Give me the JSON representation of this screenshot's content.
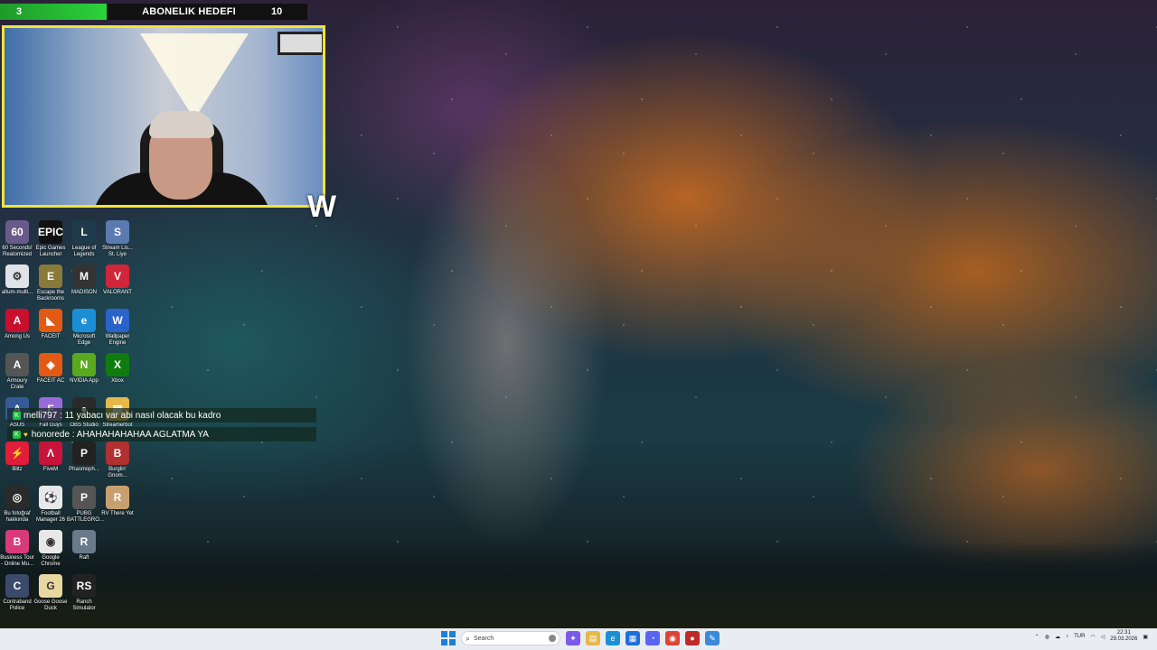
{
  "overlay": {
    "goal_count_left": "3",
    "goal_title": "ABONELIK HEDEFI",
    "goal_count_right": "10"
  },
  "desktop_icons": [
    {
      "label": "60 Seconds! Reatomized",
      "icon": "game-icon",
      "color": "#6a5a8a",
      "glyph": "60"
    },
    {
      "label": "Epic Games Launcher",
      "icon": "epic-games-icon",
      "color": "#111111",
      "glyph": "EPIC"
    },
    {
      "label": "League of Legends",
      "icon": "league-icon",
      "color": "#1f3a4a",
      "glyph": "L"
    },
    {
      "label": "Stream Lis... St. Liye",
      "icon": "stream-icon",
      "color": "#5a7ab0",
      "glyph": "S"
    },
    {
      "label": "altum-multi...",
      "icon": "file-icon",
      "color": "#dfe3e8",
      "glyph": "⚙"
    },
    {
      "label": "Escape the Backrooms",
      "icon": "game-icon",
      "color": "#8a7a3a",
      "glyph": "E"
    },
    {
      "label": "MADISON",
      "icon": "game-icon",
      "color": "#333333",
      "glyph": "M"
    },
    {
      "label": "VALORANT",
      "icon": "valorant-icon",
      "color": "#d0263a",
      "glyph": "V"
    },
    {
      "label": "Among Us",
      "icon": "among-us-icon",
      "color": "#c8102e",
      "glyph": "A"
    },
    {
      "label": "FACEIT",
      "icon": "faceit-icon",
      "color": "#e35a14",
      "glyph": "◣"
    },
    {
      "label": "Microsoft Edge",
      "icon": "edge-icon",
      "color": "#1a8fd6",
      "glyph": "e"
    },
    {
      "label": "Wallpaper Engine",
      "icon": "wallpaper-engine-icon",
      "color": "#2a64c8",
      "glyph": "W"
    },
    {
      "label": "Armoury Crate",
      "icon": "armoury-icon",
      "color": "#555555",
      "glyph": "A"
    },
    {
      "label": "FACEIT AC",
      "icon": "faceit-ac-icon",
      "color": "#e35a14",
      "glyph": "◈"
    },
    {
      "label": "NVIDIA App",
      "icon": "nvidia-icon",
      "color": "#5aa81e",
      "glyph": "N"
    },
    {
      "label": "Xbox",
      "icon": "xbox-icon",
      "color": "#107c10",
      "glyph": "X"
    },
    {
      "label": "ASUS",
      "icon": "asus-icon",
      "color": "#355a9a",
      "glyph": "A"
    },
    {
      "label": "Fall Guys",
      "icon": "fall-guys-icon",
      "color": "#9a6ad8",
      "glyph": "F"
    },
    {
      "label": "OBS Studio",
      "icon": "obs-icon",
      "color": "#2a2a2a",
      "glyph": "●"
    },
    {
      "label": "Streamerbot",
      "icon": "folder-icon",
      "color": "#e6b84a",
      "glyph": "▤"
    },
    {
      "label": "Blitz",
      "icon": "blitz-icon",
      "color": "#e01e3a",
      "glyph": "⚡"
    },
    {
      "label": "FiveM",
      "icon": "fivem-icon",
      "color": "#c8143a",
      "glyph": "Λ"
    },
    {
      "label": "Phasmoph...",
      "icon": "phasmophobia-icon",
      "color": "#222222",
      "glyph": "P"
    },
    {
      "label": "Burglin' Gnom...",
      "icon": "game-icon",
      "color": "#b23030",
      "glyph": "B"
    },
    {
      "label": "Bu fotoğraf hakkında",
      "icon": "info-icon",
      "color": "#2a2a2a",
      "glyph": "◎"
    },
    {
      "label": "Football Manager 26",
      "icon": "football-manager-icon",
      "color": "#e8e8e8",
      "glyph": "⚽"
    },
    {
      "label": "PUBG BATTLEGRO...",
      "icon": "pubg-icon",
      "color": "#555555",
      "glyph": "P"
    },
    {
      "label": "RV There Yet",
      "icon": "game-icon",
      "color": "#c8a070",
      "glyph": "R"
    },
    {
      "label": "Business Tour - Online Mu...",
      "icon": "game-icon",
      "color": "#d83a7a",
      "glyph": "B"
    },
    {
      "label": "Google Chrome",
      "icon": "chrome-icon",
      "color": "#e8e8e8",
      "glyph": "◉"
    },
    {
      "label": "Raft",
      "icon": "raft-icon",
      "color": "#6a7a8a",
      "glyph": "R"
    },
    {
      "label": "Contraband Police",
      "icon": "game-icon",
      "color": "#3a4a6a",
      "glyph": "C"
    },
    {
      "label": "Goose Goose Duck",
      "icon": "game-icon",
      "color": "#e8d8a0",
      "glyph": "G"
    },
    {
      "label": "Ranch Simulator",
      "icon": "game-icon",
      "color": "#222222",
      "glyph": "RS"
    }
  ],
  "chat": [
    {
      "text": "melli797 : 11 yabacı var abi nasıl olacak bu kadro"
    },
    {
      "text": "honorede : AHAHAHAHAHAA AGLATMA YA"
    }
  ],
  "taskbar": {
    "search_placeholder": "Search",
    "apps": [
      {
        "name": "copilot-icon",
        "color": "#7a5ae8",
        "glyph": "✦"
      },
      {
        "name": "file-explorer-icon",
        "color": "#e6b84a",
        "glyph": "▤"
      },
      {
        "name": "edge-taskbar-icon",
        "color": "#1a8fd6",
        "glyph": "e"
      },
      {
        "name": "store-icon",
        "color": "#1e6fd8",
        "glyph": "▦"
      },
      {
        "name": "discord-icon",
        "color": "#5865f2",
        "glyph": "◔"
      },
      {
        "name": "chrome-taskbar-icon",
        "color": "#db4437",
        "glyph": "◉"
      },
      {
        "name": "app-icon",
        "color": "#c02a2a",
        "glyph": "●"
      },
      {
        "name": "pen-icon",
        "color": "#3a8ad8",
        "glyph": "✎"
      }
    ],
    "language": "TUR",
    "time": "22:31",
    "date": "29.03.2026"
  }
}
